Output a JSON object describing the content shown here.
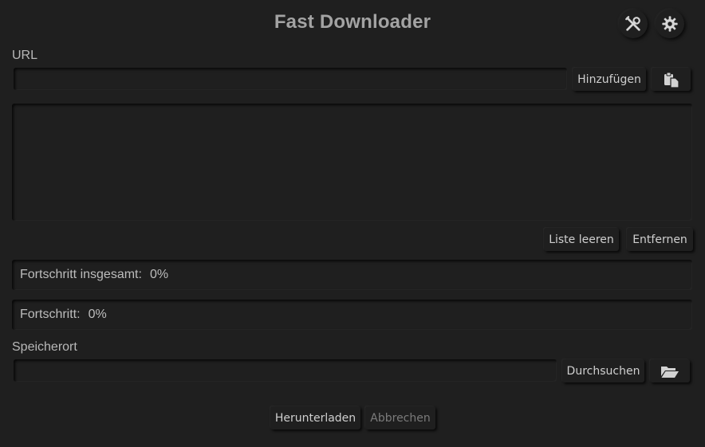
{
  "app": {
    "title": "Fast Downloader"
  },
  "header": {
    "tools_icon": "tools-icon",
    "settings_icon": "gear-icon"
  },
  "url": {
    "label": "URL",
    "value": "",
    "add_label": "Hinzufügen",
    "paste_icon": "paste-icon"
  },
  "list": {
    "items": [],
    "clear_label": "Liste leeren",
    "remove_label": "Entfernen"
  },
  "progress": {
    "total_label": "Fortschritt insgesamt:",
    "total_value": "0%",
    "current_label": "Fortschritt:",
    "current_value": "0%"
  },
  "location": {
    "label": "Speicherort",
    "value": "",
    "browse_label": "Durchsuchen",
    "folder_icon": "folder-open-icon"
  },
  "actions": {
    "download_label": "Herunterladen",
    "cancel_label": "Abbrechen"
  },
  "colors": {
    "background": "#1f1f1f",
    "text": "#c9c9c9",
    "disabled_text": "#7b7b7b"
  }
}
